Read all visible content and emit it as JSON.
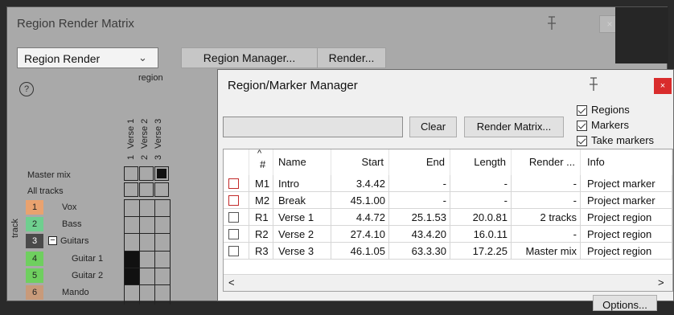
{
  "matrix_window": {
    "title": "Region Render Matrix",
    "render_select": "Region Render",
    "region_manager_btn": "Region Manager...",
    "render_btn": "Render...",
    "help_glyph": "?",
    "region_header": "region",
    "track_header": "track",
    "columns": [
      {
        "name": "Verse 1",
        "num": "1"
      },
      {
        "name": "Verse 2",
        "num": "2"
      },
      {
        "name": "Verse 3",
        "num": "3"
      }
    ],
    "master_mix_label": "Master mix",
    "all_tracks_label": "All tracks",
    "master_mix_checked": [
      false,
      false,
      true
    ],
    "tracks": [
      {
        "num": "1",
        "name": "Vox",
        "color": "#e9a26f",
        "cells": [
          false,
          false,
          false
        ]
      },
      {
        "num": "2",
        "name": "Bass",
        "color": "#6fcf8f",
        "cells": [
          false,
          false,
          false
        ]
      },
      {
        "num": "3",
        "name": "Guitars",
        "color": "#4a4a4a",
        "folder": "−",
        "cells": [
          false,
          false,
          false
        ]
      },
      {
        "num": "4",
        "name": "Guitar 1",
        "color": "#6fcf5f",
        "cells": [
          true,
          false,
          false
        ]
      },
      {
        "num": "5",
        "name": "Guitar 2",
        "color": "#6fcf5f",
        "cells": [
          true,
          false,
          false
        ]
      },
      {
        "num": "6",
        "name": "Mando",
        "color": "#c89a7a",
        "cells": [
          false,
          false,
          false
        ]
      }
    ]
  },
  "manager_window": {
    "title": "Region/Marker Manager",
    "close_glyph": "×",
    "filter_value": "",
    "clear_btn": "Clear",
    "render_matrix_btn": "Render Matrix...",
    "checkboxes": [
      {
        "label": "Regions",
        "checked": true
      },
      {
        "label": "Markers",
        "checked": true
      },
      {
        "label": "Take markers",
        "checked": true
      }
    ],
    "headers": [
      "#",
      "Name",
      "Start",
      "End",
      "Length",
      "Render ...",
      "Info"
    ],
    "sort_glyph": "^",
    "rows": [
      {
        "id": "M1",
        "name": "Intro",
        "start": "3.4.42",
        "end": "-",
        "length": "-",
        "render": "-",
        "info": "Project marker",
        "cb_color": "#c22a2a"
      },
      {
        "id": "M2",
        "name": "Break",
        "start": "45.1.00",
        "end": "-",
        "length": "-",
        "render": "-",
        "info": "Project marker",
        "cb_color": "#c22a2a"
      },
      {
        "id": "R1",
        "name": "Verse 1",
        "start": "4.4.72",
        "end": "25.1.53",
        "length": "20.0.81",
        "render": "2 tracks",
        "info": "Project region",
        "cb_color": "#555555"
      },
      {
        "id": "R2",
        "name": "Verse 2",
        "start": "27.4.10",
        "end": "43.4.20",
        "length": "16.0.11",
        "render": "-",
        "info": "Project region",
        "cb_color": "#555555"
      },
      {
        "id": "R3",
        "name": "Verse 3",
        "start": "46.1.05",
        "end": "63.3.30",
        "length": "17.2.25",
        "render": "Master mix",
        "info": "Project region",
        "cb_color": "#555555"
      }
    ],
    "scroll_left": "<",
    "scroll_right": ">",
    "options_btn": "Options..."
  }
}
